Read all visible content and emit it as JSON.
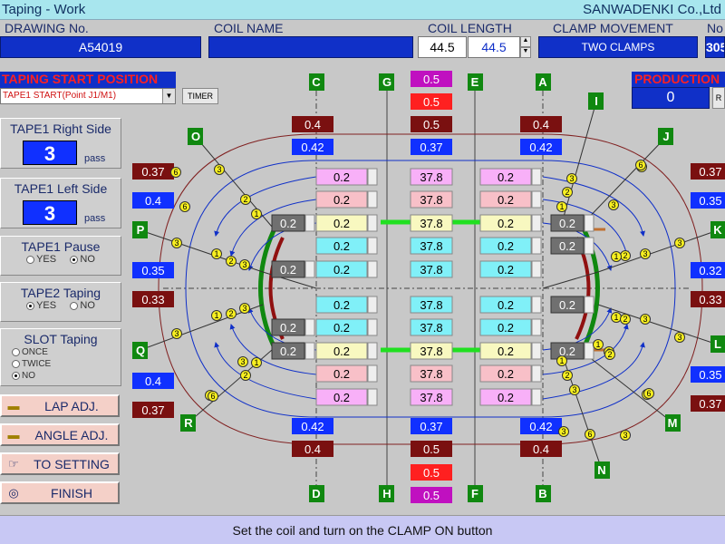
{
  "window": {
    "title": "Taping - Work",
    "company": "SANWADENKI Co.,Ltd"
  },
  "header": {
    "drawing_label": "DRAWING No.",
    "drawing_value": "A54019",
    "coil_name_label": "COIL NAME",
    "coil_name_value": "",
    "coil_length_label": "COIL LENGTH",
    "coil_length_value": "44.5",
    "coil_length_input": "44.5",
    "clamp_label": "CLAMP MOVEMENT",
    "clamp_value": "TWO CLAMPS",
    "no_label": "No",
    "no_value": "305"
  },
  "taping_start": {
    "title": "TAPING START POSITION",
    "selected": "TAPE1 START(Point J1/M1)",
    "timer_label": "TIMER"
  },
  "tape1_right": {
    "title": "TAPE1 Right Side",
    "value": "3",
    "unit": "pass"
  },
  "tape1_left": {
    "title": "TAPE1 Left Side",
    "value": "3",
    "unit": "pass"
  },
  "tape1_pause": {
    "title": "TAPE1 Pause",
    "yes": "YES",
    "no": "NO",
    "selected": "NO"
  },
  "tape2_taping": {
    "title": "TAPE2 Taping",
    "yes": "YES",
    "no": "NO",
    "selected": "YES"
  },
  "slot_taping": {
    "title": "SLOT Taping",
    "options": [
      "ONCE",
      "TWICE",
      "NO"
    ],
    "selected": "NO"
  },
  "buttons": {
    "lap_adj": "LAP ADJ.",
    "angle_adj": "ANGLE ADJ.",
    "to_setting": "TO SETTING",
    "finish": "FINISH"
  },
  "production": {
    "title": "PRODUCTION",
    "value": "0",
    "reset_label": "R"
  },
  "diagram": {
    "top_letters": [
      "C",
      "G",
      "E",
      "A"
    ],
    "bottom_letters": [
      "D",
      "H",
      "F",
      "B"
    ],
    "side_letters": {
      "O": "O",
      "P": "P",
      "Q": "Q",
      "R": "R",
      "I": "I",
      "J": "J",
      "K": "K",
      "L": "L",
      "M": "M",
      "N": "N"
    },
    "top_values": {
      "magenta": "0.5",
      "red": "0.5",
      "maroon_center": "0.5",
      "maroon_left": "0.4",
      "maroon_right": "0.4",
      "blue_left": "0.42",
      "blue_center": "0.37",
      "blue_right": "0.42"
    },
    "bottom_values": {
      "blue_left": "0.42",
      "blue_center": "0.37",
      "blue_right": "0.42",
      "maroon_left": "0.4",
      "maroon_center": "0.5",
      "maroon_right": "0.4",
      "red": "0.5",
      "magenta": "0.5"
    },
    "left_values": [
      "0.37",
      "0.4",
      "0.35",
      "0.33",
      "0.4",
      "0.37"
    ],
    "right_values": [
      "0.37",
      "0.35",
      "0.32",
      "0.33",
      "0.35",
      "0.37"
    ],
    "rows": [
      {
        "l": "0.2",
        "c": "37.8",
        "r": "0.2",
        "color": "#f8b0f8"
      },
      {
        "l": "0.2",
        "c": "37.8",
        "r": "0.2",
        "color": "#f8c0c8"
      },
      {
        "l": "0.2",
        "c": "37.8",
        "r": "0.2",
        "color": "#f8f8c0"
      },
      {
        "l": "0.2",
        "c": "37.8",
        "r": "0.2",
        "color": "#80f0f8"
      },
      {
        "l": "0.2",
        "c": "37.8",
        "r": "0.2",
        "color": "#80f0f8"
      },
      {
        "l": "0.2",
        "c": "37.8",
        "r": "0.2",
        "color": "#80f0f8"
      },
      {
        "l": "0.2",
        "c": "37.8",
        "r": "0.2",
        "color": "#80f0f8"
      },
      {
        "l": "0.2",
        "c": "37.8",
        "r": "0.2",
        "color": "#f8f8c0"
      },
      {
        "l": "0.2",
        "c": "37.8",
        "r": "0.2",
        "color": "#f8c0c8"
      },
      {
        "l": "0.2",
        "c": "37.8",
        "r": "0.2",
        "color": "#f8b0f8"
      }
    ],
    "grey_values": [
      "0.2",
      "0.2",
      "0.2",
      "0.2",
      "0.2",
      "0.2",
      "0.2",
      "0.2"
    ],
    "markers": [
      "1",
      "2",
      "3",
      "6"
    ]
  },
  "status": {
    "message": "Set the coil and turn on the CLAMP ON button"
  },
  "colors": {
    "navy": "#1030c8",
    "maroon": "#7a1010",
    "red": "#ff2020",
    "magenta": "#c010c0",
    "green": "#108810"
  }
}
